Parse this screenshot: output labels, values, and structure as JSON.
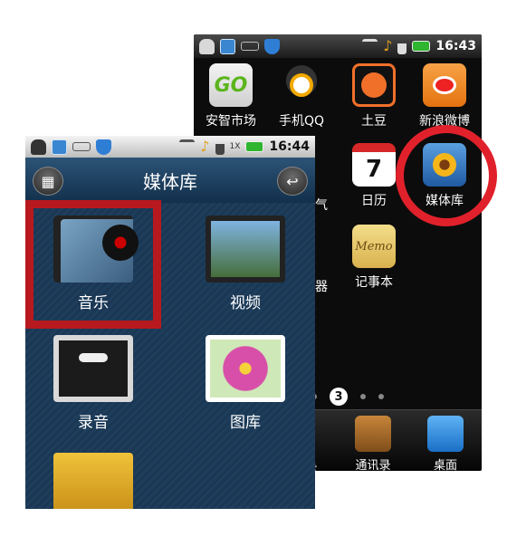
{
  "back_phone": {
    "status_time": "16:43",
    "apps_row1": [
      "安智市场",
      "手机QQ",
      "土豆",
      "新浪微博"
    ],
    "apps_row2_partial": "气",
    "apps_row2": [
      "日历",
      "媒体库"
    ],
    "apps_row3_partial": "器",
    "apps_row3": [
      "记事本"
    ],
    "calendar_day": "7",
    "memo_text": "Memo",
    "bag_text": "GO",
    "page_indicator": "3",
    "dock": {
      "partial": "盘",
      "contacts": "通讯录",
      "home": "桌面"
    }
  },
  "front_phone": {
    "status_time": "16:44",
    "title": "媒体库",
    "items": [
      "音乐",
      "视频",
      "录音",
      "图库"
    ],
    "signal_text": "1X"
  },
  "colors": {
    "highlight_red": "#e0212b",
    "box_red": "#b8191f"
  }
}
